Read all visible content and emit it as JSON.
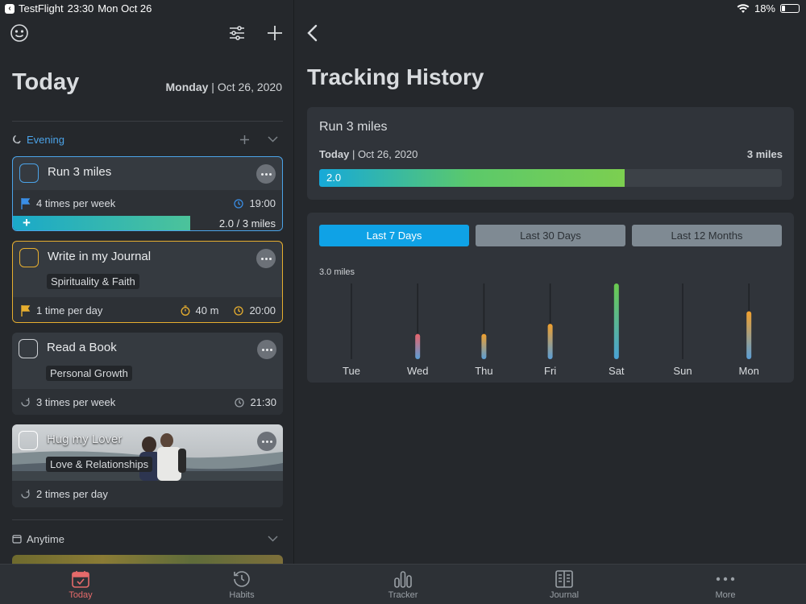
{
  "status_bar": {
    "app": "TestFlight",
    "time": "23:30",
    "date": "Mon Oct 26",
    "battery": "18%"
  },
  "today": {
    "title": "Today",
    "weekday": "Monday",
    "date": "Oct 26, 2020"
  },
  "sections": {
    "evening": {
      "label": "Evening"
    },
    "anytime": {
      "label": "Anytime"
    }
  },
  "habits": [
    {
      "title": "Run 3 miles",
      "frequency": "4 times per week",
      "time": "19:00",
      "progress_label": "2.0 / 3 miles",
      "progress": 0.66
    },
    {
      "title": "Write in my Journal",
      "tag": "Spirituality & Faith",
      "frequency": "1 time per day",
      "duration": "40 m",
      "time": "20:00"
    },
    {
      "title": "Read a Book",
      "tag": "Personal Growth",
      "frequency": "3 times per week",
      "time": "21:30"
    },
    {
      "title": "Hug my Lover",
      "tag": "Love & Relationships",
      "frequency": "2 times per day"
    }
  ],
  "history": {
    "title": "Tracking History",
    "habit_title": "Run 3 miles",
    "date_prefix": "Today",
    "date": "Oct 26, 2020",
    "goal": "3 miles",
    "value_label": "2.0",
    "progress": 0.66,
    "ranges": [
      "Last 7 Days",
      "Last 30 Days",
      "Last 12 Months"
    ],
    "active_range": 0
  },
  "chart_data": {
    "type": "bar",
    "ylabel": "3.0 miles",
    "ylim": [
      0,
      3.0
    ],
    "categories": [
      "Tue",
      "Wed",
      "Thu",
      "Fri",
      "Sat",
      "Sun",
      "Mon"
    ],
    "values": [
      0,
      1.0,
      1.0,
      1.4,
      3.0,
      0,
      1.9
    ]
  },
  "tabs": [
    {
      "label": "Today"
    },
    {
      "label": "Habits"
    },
    {
      "label": "Tracker"
    },
    {
      "label": "Journal"
    },
    {
      "label": "More"
    }
  ],
  "colors": {
    "accent": "#0fa2e6",
    "active_tab": "#e56a6a",
    "selected_blue": "#4ba3e8",
    "selected_yellow": "#e7ae2f"
  }
}
